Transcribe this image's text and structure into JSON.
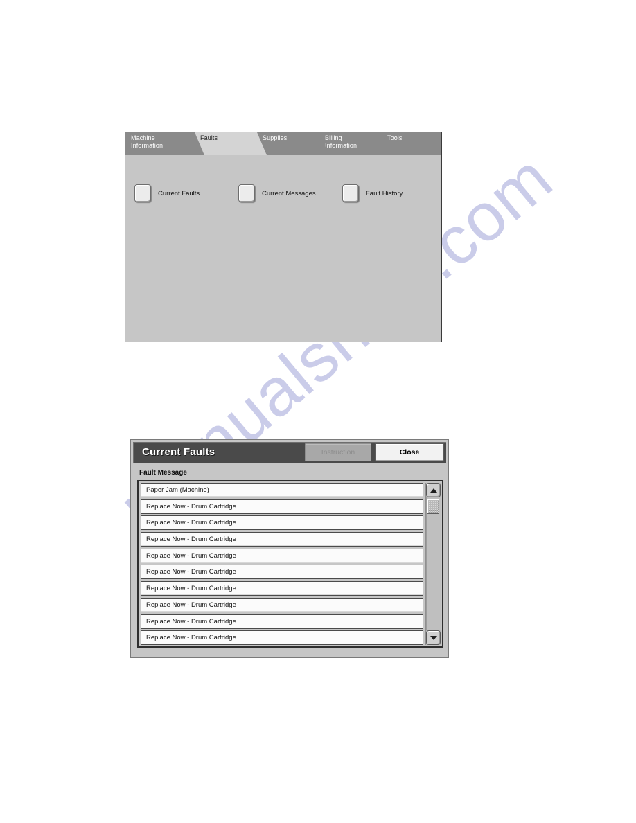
{
  "watermark": {
    "text": "manualshive.com"
  },
  "machine_screen": {
    "tabs": [
      {
        "label": "Machine\nInformation",
        "name": "machine-information",
        "active": false
      },
      {
        "label": "Faults",
        "name": "faults",
        "active": true
      },
      {
        "label": "Supplies",
        "name": "supplies",
        "active": false
      },
      {
        "label": "Billing\nInformation",
        "name": "billing-information",
        "active": false
      },
      {
        "label": "Tools",
        "name": "tools",
        "active": false
      }
    ],
    "features": [
      {
        "label": "Current Faults...",
        "name": "current-faults"
      },
      {
        "label": "Current Messages...",
        "name": "current-messages"
      },
      {
        "label": "Fault History...",
        "name": "fault-history"
      }
    ]
  },
  "dialog": {
    "title": "Current Faults",
    "buttons": {
      "instruction": "Instruction",
      "close": "Close"
    },
    "instruction_disabled": true,
    "column_header": "Fault Message",
    "rows": [
      "Paper Jam (Machine)",
      "Replace Now - Drum Cartridge",
      "Replace Now - Drum Cartridge",
      "Replace Now - Drum Cartridge",
      "Replace Now - Drum Cartridge",
      "Replace Now - Drum Cartridge",
      "Replace Now - Drum Cartridge",
      "Replace Now - Drum Cartridge",
      "Replace Now - Drum Cartridge",
      "Replace Now - Drum Cartridge"
    ],
    "scrollbar": {
      "up_icon": "triangle-up-icon",
      "down_icon": "triangle-down-icon",
      "thumb_position": "top"
    }
  },
  "colors": {
    "panel_bg": "#c6c6c6",
    "tabstrip_bg": "#262626",
    "tab_inactive": "#8a8a8a",
    "tab_active": "#d4d4d4",
    "dialog_header": "#4a4a4a",
    "row_bg": "#fbfbfb",
    "watermark": "#8b8fd0"
  }
}
